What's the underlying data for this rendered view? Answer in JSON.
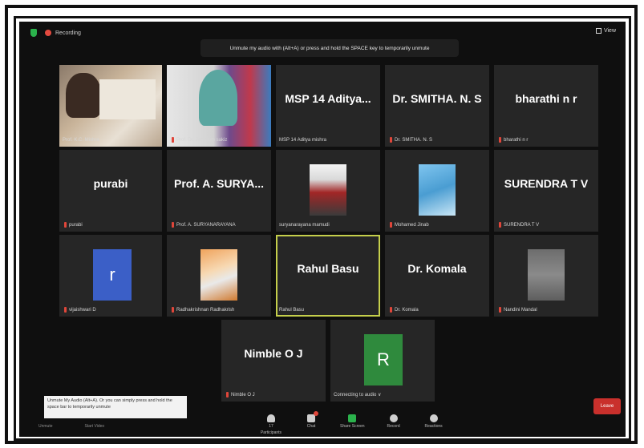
{
  "topbar": {
    "recording_label": "Recording",
    "view_label": "View"
  },
  "toast": "Unmute my audio with (Alt+A) or press and hold the SPACE key to temporarily unmute",
  "tiles": [
    {
      "name": "Prof. K.C. Mishra"
    },
    {
      "name": "Prof. Dr. Jamalum sakiz"
    },
    {
      "display": "MSP 14 Aditya...",
      "name": "MSP 14 Aditya mishra"
    },
    {
      "display": "Dr. SMITHA. N. S",
      "name": "Dr. SMITHA. N. S"
    },
    {
      "display": "bharathi n r",
      "name": "bharathi n r"
    },
    {
      "display": "purabi",
      "name": "purabi"
    },
    {
      "display": "Prof. A. SURYA...",
      "name": "Prof. A. SURYANARAYANA"
    },
    {
      "name": "suryanarayana mamudi"
    },
    {
      "name": "Mohamed Jinab"
    },
    {
      "display": "SURENDRA T V",
      "name": "SURENDRA T V"
    },
    {
      "avatar": "r",
      "avatar_color": "#3b5fc7",
      "name": "vijaishwari D"
    },
    {
      "name": "Radhakrishnan Radhakrish"
    },
    {
      "display": "Rahul Basu",
      "name": "Rahul Basu"
    },
    {
      "display": "Dr. Komala",
      "name": "Dr. Komala"
    },
    {
      "name": "Nandini Mandal"
    },
    {
      "display": "Nimble O J",
      "name": "Nimble O J"
    },
    {
      "avatar": "R",
      "avatar_color": "#2f8a3d",
      "name": "Connecting to audio ∨"
    }
  ],
  "bottom_note": "Unmute My Audio (Alt+A). Or you can simply press and hold the space bar to temporarily unmute",
  "controls": {
    "unmute": "Unmute",
    "start_video": "Start Video"
  },
  "toolbar": {
    "participants": "Participants",
    "participants_count": "17",
    "chat": "Chat",
    "share": "Share Screen",
    "record": "Record",
    "reactions": "Reactions",
    "leave": "Leave"
  }
}
